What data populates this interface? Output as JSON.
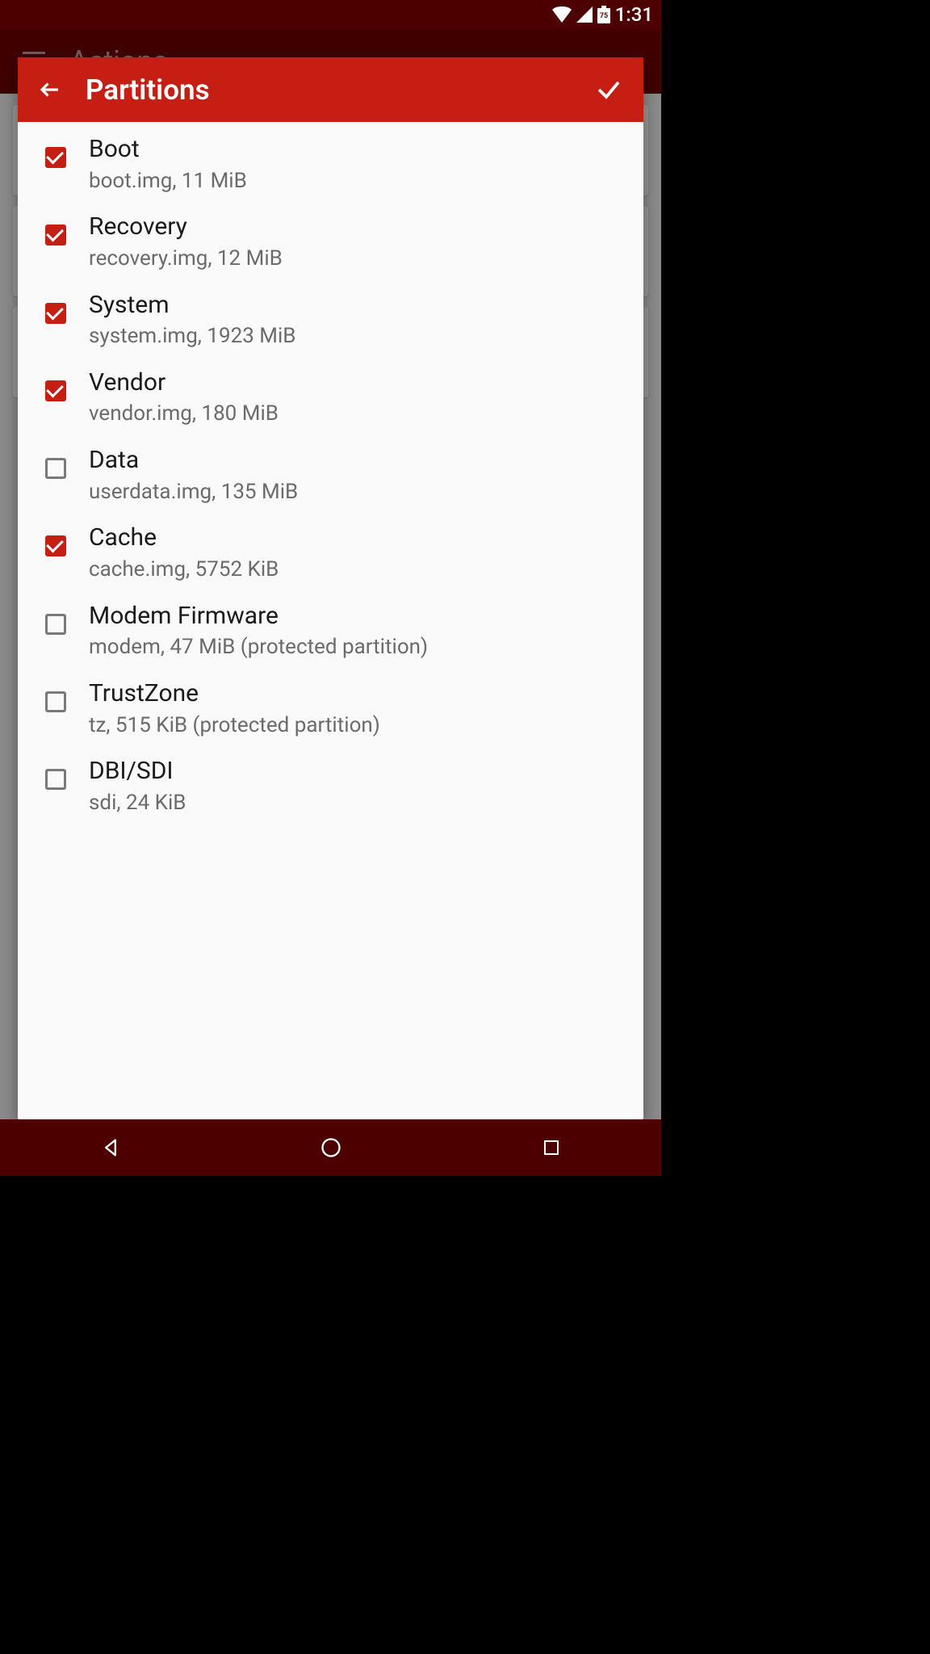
{
  "status": {
    "time": "1:31",
    "battery": "75"
  },
  "bg_app": {
    "title": "Actions"
  },
  "dialog": {
    "title": "Partitions"
  },
  "partitions": [
    {
      "primary": "Boot",
      "secondary": "boot.img, 11 MiB",
      "checked": true
    },
    {
      "primary": "Recovery",
      "secondary": "recovery.img, 12 MiB",
      "checked": true
    },
    {
      "primary": "System",
      "secondary": "system.img, 1923 MiB",
      "checked": true
    },
    {
      "primary": "Vendor",
      "secondary": "vendor.img, 180 MiB",
      "checked": true
    },
    {
      "primary": "Data",
      "secondary": "userdata.img, 135 MiB",
      "checked": false
    },
    {
      "primary": "Cache",
      "secondary": "cache.img, 5752 KiB",
      "checked": true
    },
    {
      "primary": "Modem Firmware",
      "secondary": "modem, 47 MiB (protected partition)",
      "checked": false
    },
    {
      "primary": "TrustZone",
      "secondary": "tz, 515 KiB (protected partition)",
      "checked": false
    },
    {
      "primary": "DBI/SDI",
      "secondary": "sdi, 24 KiB",
      "checked": false
    }
  ]
}
